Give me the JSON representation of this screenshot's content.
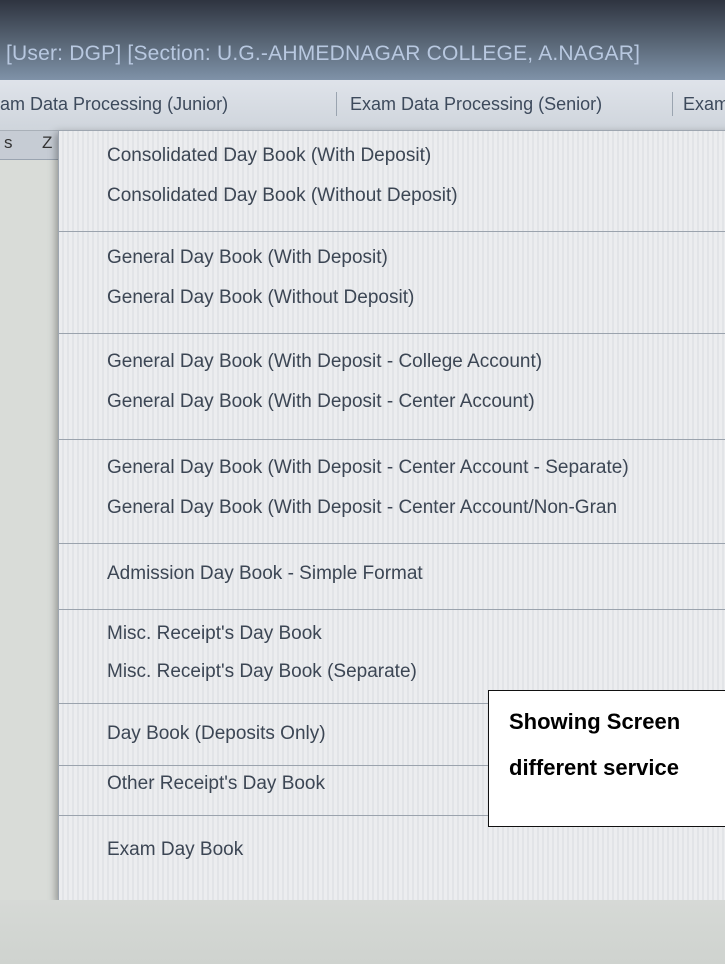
{
  "window": {
    "title": "[User: DGP] [Section: U.G.-AHMEDNAGAR COLLEGE, A.NAGAR]"
  },
  "menu_bar": {
    "items": [
      "am Data Processing (Junior)",
      "Exam Data Processing (Senior)",
      "Exam"
    ]
  },
  "toolbar": {
    "glyph_1": "s",
    "glyph_2": "Z"
  },
  "dropdown": {
    "groups": [
      [
        "Consolidated Day Book (With Deposit)",
        "Consolidated Day Book (Without Deposit)"
      ],
      [
        "General Day Book (With Deposit)",
        "General Day Book (Without Deposit)"
      ],
      [
        "General Day Book (With Deposit - College Account)",
        "General Day Book (With Deposit - Center Account)"
      ],
      [
        "General Day Book (With Deposit - Center Account - Separate)",
        "General Day Book (With Deposit - Center Account/Non-Gran"
      ],
      [
        "Admission Day Book - Simple Format"
      ],
      [
        "Misc. Receipt's Day Book",
        "Misc. Receipt's Day Book (Separate)"
      ],
      [
        "Day Book (Deposits Only)"
      ],
      [
        "Other Receipt's Day Book"
      ],
      [
        "Exam Day Book"
      ]
    ]
  },
  "callout": {
    "line1": "Showing Screen",
    "line2": "different service"
  }
}
